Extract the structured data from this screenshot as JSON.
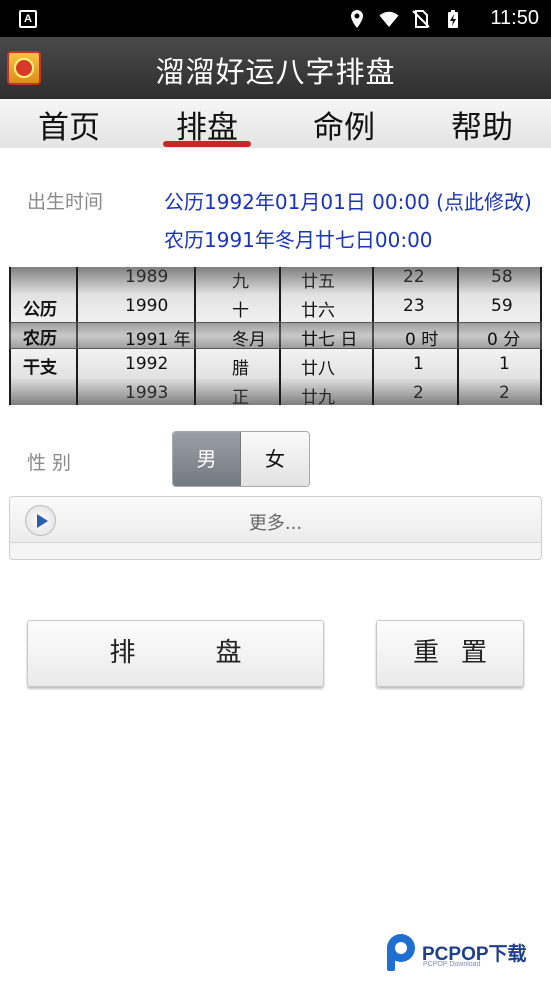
{
  "status_bar": {
    "time": "11:50",
    "left_badge": "A",
    "icons": [
      "location-icon",
      "wifi-icon",
      "no-sim-icon",
      "battery-charging-icon"
    ]
  },
  "app": {
    "title": "溜溜好运八字排盘",
    "logo_icon": "ming-logo-icon"
  },
  "tabs": [
    {
      "label": "首页",
      "active": false
    },
    {
      "label": "排盘",
      "active": true
    },
    {
      "label": "命例",
      "active": false
    },
    {
      "label": "帮助",
      "active": false
    }
  ],
  "birth": {
    "label": "出生时间",
    "solar": "公历1992年01月01日 00:00 (点此修改)",
    "lunar": "农历1991年冬月廿七日00:00"
  },
  "picker": {
    "row_labels": [
      "公历",
      "农历",
      "干支"
    ],
    "columns": [
      {
        "items": [
          "1989",
          "1990",
          "1991 年",
          "1992",
          "1993"
        ]
      },
      {
        "items": [
          "九",
          "十",
          "冬月",
          "腊",
          "正"
        ]
      },
      {
        "items": [
          "廿五",
          "廿六",
          "廿七 日",
          "廿八",
          "廿九"
        ]
      },
      {
        "items": [
          "22",
          "23",
          "0 时",
          "1",
          "2"
        ]
      },
      {
        "items": [
          "58",
          "59",
          "0 分",
          "1",
          "2"
        ]
      }
    ]
  },
  "gender": {
    "label": "性 别",
    "options": [
      "男",
      "女"
    ],
    "selected": "男"
  },
  "more": {
    "label": "更多..."
  },
  "buttons": {
    "calculate": "排盘",
    "reset": "重置"
  },
  "watermark": {
    "text": "PCPOP下载",
    "sub": "PCPOP Download"
  },
  "colors": {
    "link_blue": "#1a35b5",
    "tab_indicator": "#c62828",
    "app_bar": "#3a3a3a"
  }
}
